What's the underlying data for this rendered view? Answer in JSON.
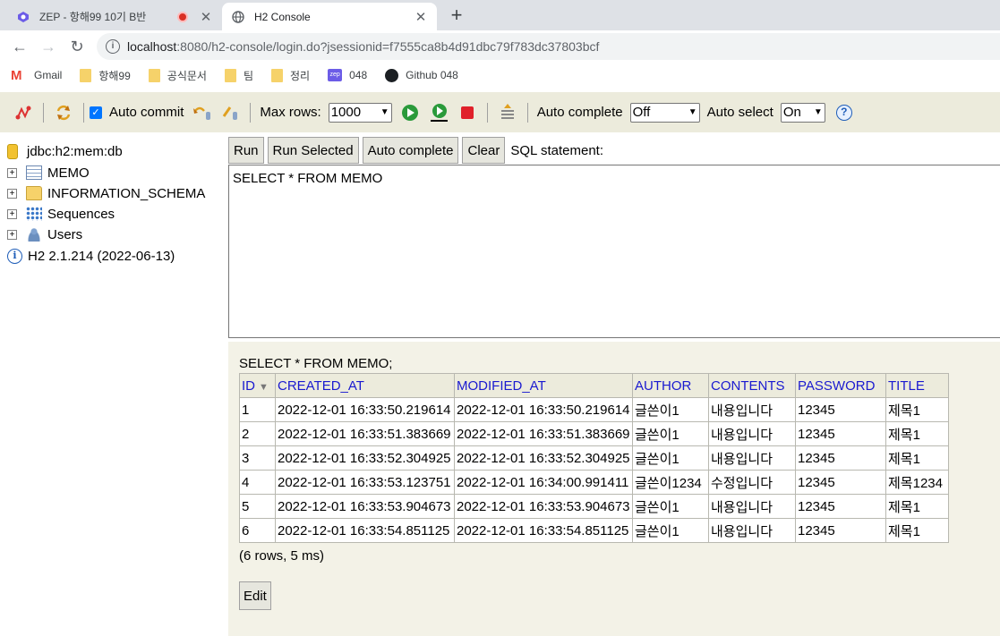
{
  "browser": {
    "tabs": [
      {
        "title": "ZEP - 항해99 10기 B반",
        "active": false
      },
      {
        "title": "H2 Console",
        "active": true
      }
    ],
    "url_host": "localhost",
    "url_path": ":8080/h2-console/login.do?jsessionid=f7555ca8b4d91dbc79f783dc37803bcf",
    "bookmarks": [
      "Gmail",
      "항해99",
      "공식문서",
      "팀",
      "정리",
      "048",
      "Github 048"
    ]
  },
  "toolbar": {
    "auto_commit_label": "Auto commit",
    "max_rows_label": "Max rows:",
    "max_rows_value": "1000",
    "auto_complete_label": "Auto complete",
    "auto_complete_value": "Off",
    "auto_select_label": "Auto select",
    "auto_select_value": "On"
  },
  "tree": {
    "connection": "jdbc:h2:mem:db",
    "nodes": [
      "MEMO",
      "INFORMATION_SCHEMA",
      "Sequences",
      "Users"
    ],
    "version": "H2 2.1.214 (2022-06-13)"
  },
  "query": {
    "buttons": [
      "Run",
      "Run Selected",
      "Auto complete",
      "Clear"
    ],
    "sql_label": "SQL statement:",
    "sql_text": "SELECT * FROM MEMO"
  },
  "results": {
    "statement": "SELECT * FROM MEMO;",
    "columns": [
      "ID",
      "CREATED_AT",
      "MODIFIED_AT",
      "AUTHOR",
      "CONTENTS",
      "PASSWORD",
      "TITLE"
    ],
    "rows": [
      [
        "1",
        "2022-12-01 16:33:50.219614",
        "2022-12-01 16:33:50.219614",
        "글쓴이1",
        "내용입니다",
        "12345",
        "제목1"
      ],
      [
        "2",
        "2022-12-01 16:33:51.383669",
        "2022-12-01 16:33:51.383669",
        "글쓴이1",
        "내용입니다",
        "12345",
        "제목1"
      ],
      [
        "3",
        "2022-12-01 16:33:52.304925",
        "2022-12-01 16:33:52.304925",
        "글쓴이1",
        "내용입니다",
        "12345",
        "제목1"
      ],
      [
        "4",
        "2022-12-01 16:33:53.123751",
        "2022-12-01 16:34:00.991411",
        "글쓴이1234",
        "수정입니다",
        "12345",
        "제목1234"
      ],
      [
        "5",
        "2022-12-01 16:33:53.904673",
        "2022-12-01 16:33:53.904673",
        "글쓴이1",
        "내용입니다",
        "12345",
        "제목1"
      ],
      [
        "6",
        "2022-12-01 16:33:54.851125",
        "2022-12-01 16:33:54.851125",
        "글쓴이1",
        "내용입니다",
        "12345",
        "제목1"
      ]
    ],
    "summary": "(6 rows, 5 ms)",
    "edit_label": "Edit"
  }
}
